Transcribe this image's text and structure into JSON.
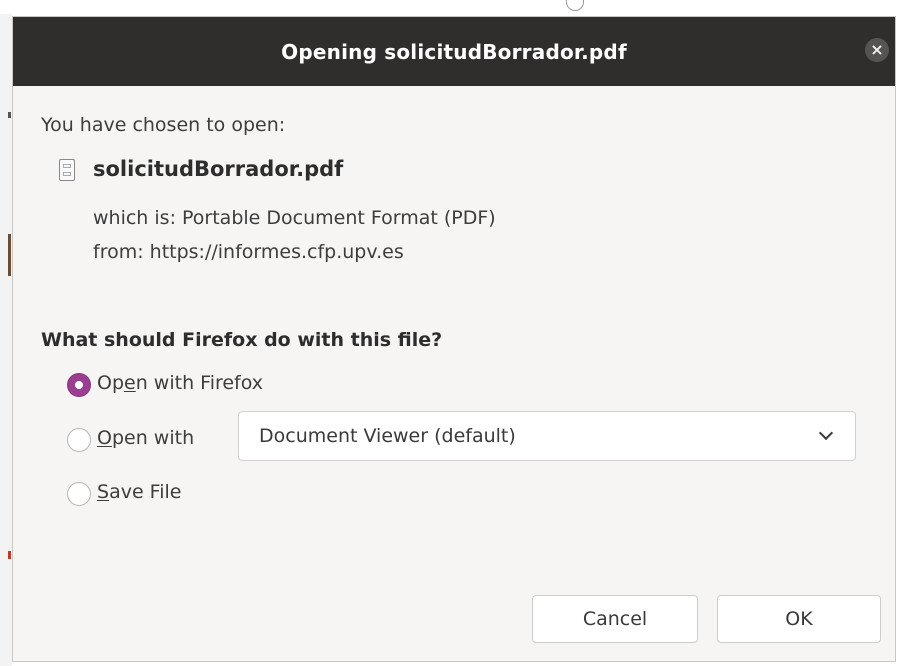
{
  "dialog": {
    "title": "Opening solicitudBorrador.pdf",
    "close_glyph": "×"
  },
  "file": {
    "intro": "You have chosen to open:",
    "name": "solicitudBorrador.pdf",
    "which_is": "which is: Portable Document Format (PDF)",
    "from": "from: https://informes.cfp.upv.es",
    "icon": "document-icon"
  },
  "action": {
    "question": "What should Firefox do with this file?",
    "options": [
      {
        "prefix": "Op",
        "mnemonic": "e",
        "suffix": "n with Firefox",
        "selected": true
      },
      {
        "prefix": "",
        "mnemonic": "O",
        "suffix": "pen with",
        "selected": false
      },
      {
        "prefix": "",
        "mnemonic": "S",
        "suffix": "ave File",
        "selected": false
      }
    ],
    "app_selector": {
      "value": "Document Viewer (default)"
    }
  },
  "buttons": {
    "cancel": "Cancel",
    "ok": "OK"
  },
  "colors": {
    "titlebar": "#2f2e2c",
    "accent": "#9a3f8f",
    "dialog_bg": "#f6f5f4"
  }
}
